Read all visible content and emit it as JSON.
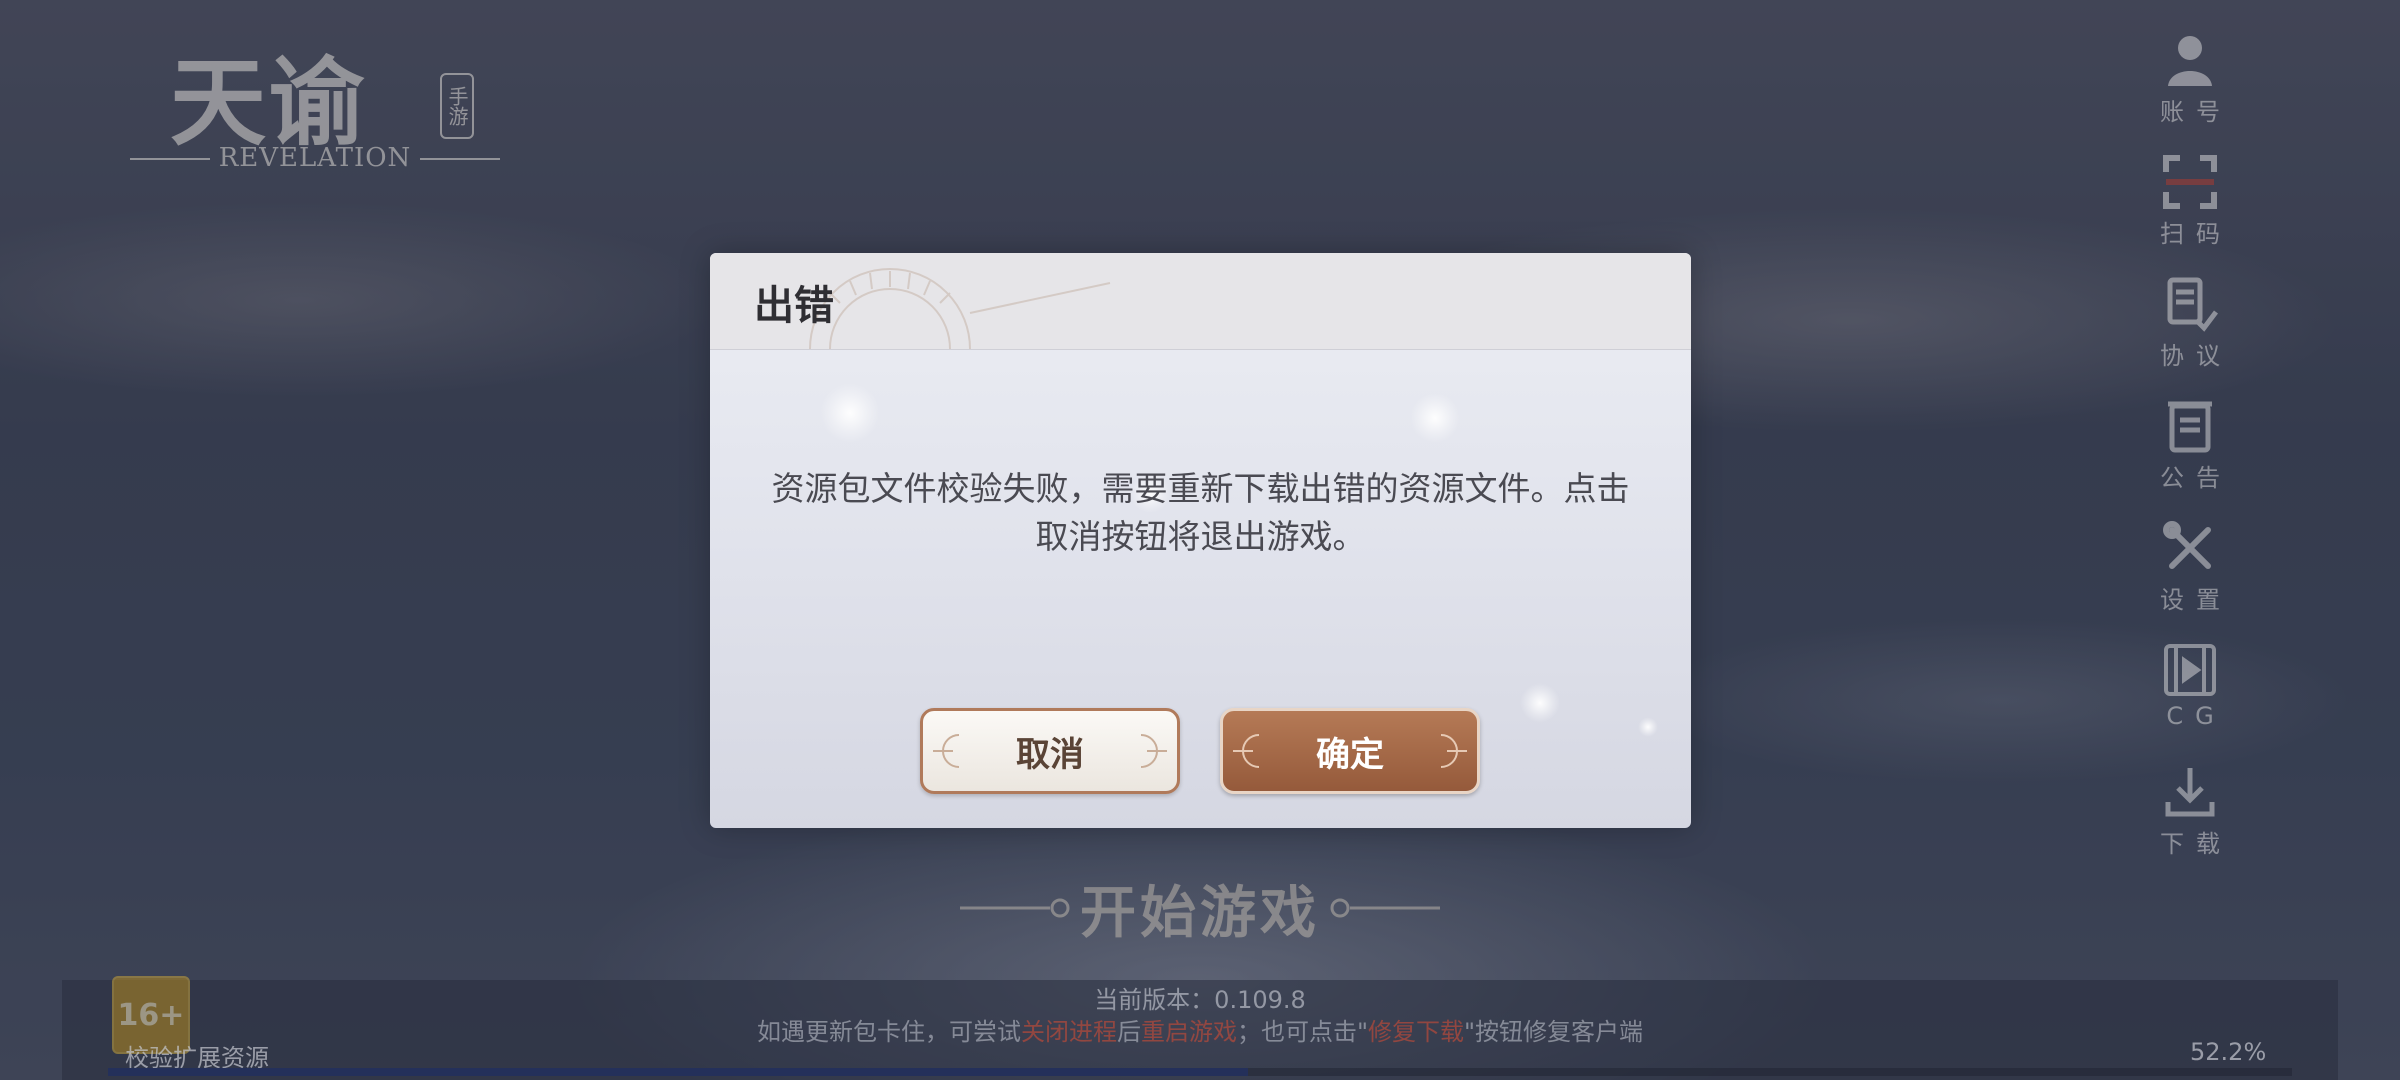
{
  "logo": {
    "title": "天谕",
    "badge": "手游",
    "subtitle": "REVELATION"
  },
  "side_menu": {
    "items": [
      {
        "label": "账号",
        "icon": "account-icon"
      },
      {
        "label": "扫码",
        "icon": "scan-icon"
      },
      {
        "label": "协议",
        "icon": "agreement-icon"
      },
      {
        "label": "公告",
        "icon": "announcement-icon"
      },
      {
        "label": "设置",
        "icon": "settings-icon"
      },
      {
        "label": "CG",
        "icon": "video-icon"
      },
      {
        "label": "下载",
        "icon": "download-icon"
      }
    ]
  },
  "start_button": {
    "label": "开始游戏"
  },
  "footer": {
    "version": "当前版本：0.109.8",
    "hint_prefix": "如遇更新包卡住，可尝试",
    "hint_red1": "关闭进程",
    "hint_mid1": "后",
    "hint_red2": "重启游戏",
    "hint_mid2": "；也可点击\"",
    "hint_red3": "修复下载",
    "hint_suffix": "\"按钮修复客户端",
    "age_badge": "16+",
    "progress_label": "校验扩展资源",
    "progress_percent": "52.2%",
    "progress_value": 0.522
  },
  "dialog": {
    "title": "出错",
    "message": "资源包文件校验失败，需要重新下载出错的资源文件。点击取消按钮将退出游戏。",
    "cancel_label": "取消",
    "confirm_label": "确定"
  },
  "colors": {
    "confirm_button": "#a86a47",
    "cancel_border": "#b07a5b",
    "hint_highlight": "#b84a3a"
  }
}
